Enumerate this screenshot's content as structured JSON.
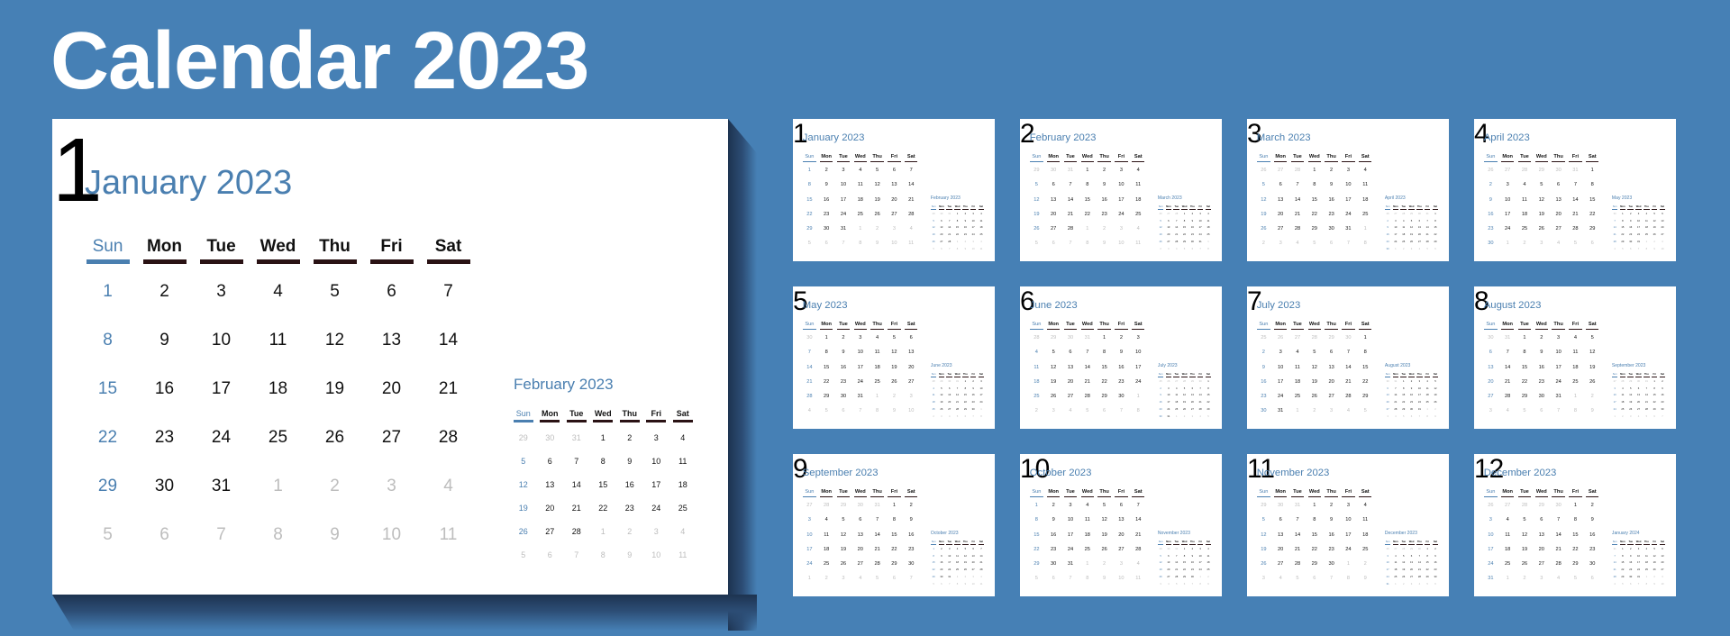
{
  "title": "Calendar 2023",
  "colors": {
    "background": "#4680b5",
    "accent": "#4a7fb0",
    "weekday_bar": "#2a1214",
    "outside_day": "#bdbdbd"
  },
  "weekdays": [
    "Sun",
    "Mon",
    "Tue",
    "Wed",
    "Thu",
    "Fri",
    "Sat"
  ],
  "months": [
    {
      "number": "1",
      "title": "January 2023",
      "next_title": "February 2023",
      "start": 0,
      "days": 31,
      "prev_days": 31,
      "next_start": 3,
      "next_days": 28,
      "next_prev_days": 31
    },
    {
      "number": "2",
      "title": "February 2023",
      "next_title": "March 2023",
      "start": 3,
      "days": 28,
      "prev_days": 31,
      "next_start": 3,
      "next_days": 31,
      "next_prev_days": 28
    },
    {
      "number": "3",
      "title": "March 2023",
      "next_title": "April 2023",
      "start": 3,
      "days": 31,
      "prev_days": 28,
      "next_start": 6,
      "next_days": 30,
      "next_prev_days": 31
    },
    {
      "number": "4",
      "title": "April 2023",
      "next_title": "May 2023",
      "start": 6,
      "days": 30,
      "prev_days": 31,
      "next_start": 1,
      "next_days": 31,
      "next_prev_days": 30
    },
    {
      "number": "5",
      "title": "May 2023",
      "next_title": "June 2023",
      "start": 1,
      "days": 31,
      "prev_days": 30,
      "next_start": 4,
      "next_days": 30,
      "next_prev_days": 31
    },
    {
      "number": "6",
      "title": "June 2023",
      "next_title": "July 2023",
      "start": 4,
      "days": 30,
      "prev_days": 31,
      "next_start": 6,
      "next_days": 31,
      "next_prev_days": 30
    },
    {
      "number": "7",
      "title": "July 2023",
      "next_title": "August 2023",
      "start": 6,
      "days": 31,
      "prev_days": 30,
      "next_start": 2,
      "next_days": 31,
      "next_prev_days": 31
    },
    {
      "number": "8",
      "title": "August 2023",
      "next_title": "September 2023",
      "start": 2,
      "days": 31,
      "prev_days": 31,
      "next_start": 5,
      "next_days": 30,
      "next_prev_days": 31
    },
    {
      "number": "9",
      "title": "September 2023",
      "next_title": "October 2023",
      "start": 5,
      "days": 30,
      "prev_days": 31,
      "next_start": 0,
      "next_days": 31,
      "next_prev_days": 30
    },
    {
      "number": "10",
      "title": "October 2023",
      "next_title": "November 2023",
      "start": 0,
      "days": 31,
      "prev_days": 30,
      "next_start": 3,
      "next_days": 30,
      "next_prev_days": 31
    },
    {
      "number": "11",
      "title": "November 2023",
      "next_title": "December 2023",
      "start": 3,
      "days": 30,
      "prev_days": 31,
      "next_start": 5,
      "next_days": 31,
      "next_prev_days": 30
    },
    {
      "number": "12",
      "title": "December 2023",
      "next_title": "January 2024",
      "start": 5,
      "days": 31,
      "prev_days": 30,
      "next_start": 1,
      "next_days": 31,
      "next_prev_days": 31
    }
  ]
}
